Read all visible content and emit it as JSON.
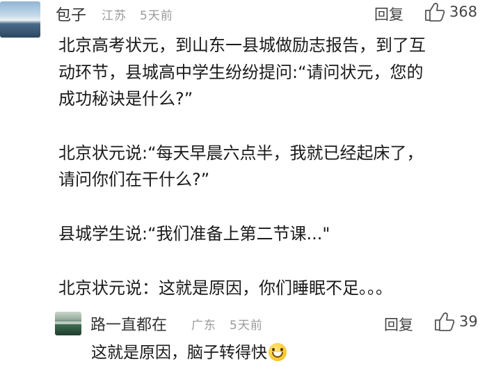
{
  "comment1": {
    "username": "包子",
    "location": "江苏",
    "time": "5天前",
    "reply_label": "回复",
    "like_count": "368",
    "lines": [
      "北京高考状元，到山东一县城做励志报告，到了互",
      "动环节，县城高中学生纷纷提问:“请问状元，您的",
      "成功秘诀是什么?”",
      "北京状元说:“每天早晨六点半，我就已经起床了，",
      "请问你们在干什么?”",
      "县城学生说:“我们准备上第二节课...\"",
      "北京状元说：这就是原因，你们睡眠不足。。。"
    ]
  },
  "comment2": {
    "username": "路一直都在",
    "location": "广东",
    "time": "5天前",
    "reply_label": "回复",
    "like_count": "39",
    "text": "这就是原因，脑子转得快"
  },
  "icons": {
    "like": "thumbs-up-icon",
    "emoji": "grinning-face-emoji"
  }
}
